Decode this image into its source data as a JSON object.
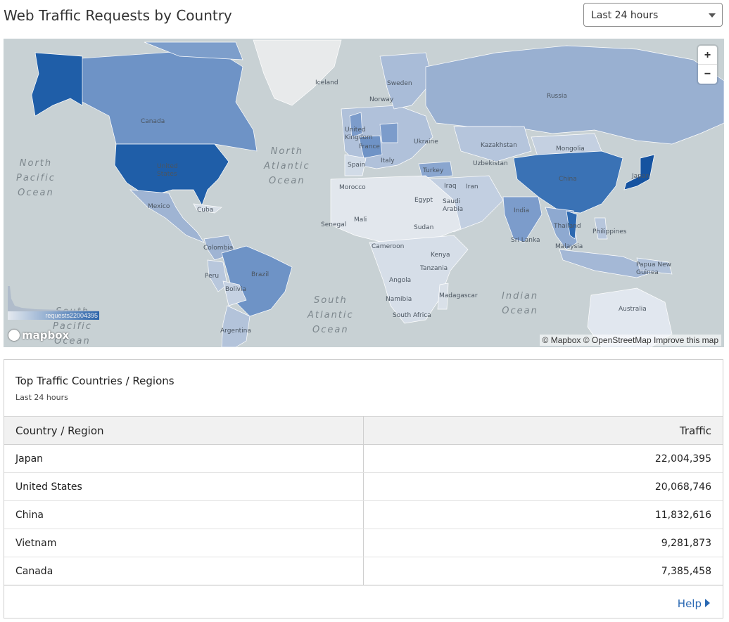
{
  "header": {
    "title": "Web Traffic Requests by Country",
    "range_select": {
      "selected": "Last 24 hours"
    }
  },
  "map": {
    "zoom_in": "+",
    "zoom_out": "−",
    "legend": {
      "label": "requests",
      "max_value": "22004395"
    },
    "logo": "mapbox",
    "attribution": "© Mapbox © OpenStreetMap Improve this map",
    "ocean_labels": {
      "north_pacific": "North\nPacific\nOcean",
      "north_atlantic": "North\nAtlantic\nOcean",
      "south_atlantic": "South\nAtlantic\nOcean",
      "indian": "Indian\nOcean",
      "south_pacific": "South\nPacific\nOcean"
    },
    "country_labels": [
      "Iceland",
      "Sweden",
      "Norway",
      "Russia",
      "United Kingdom",
      "France",
      "Ukraine",
      "Kazakhstan",
      "Mongolia",
      "Spain",
      "Italy",
      "Uzbekistan",
      "Turkey",
      "Morocco",
      "Iraq",
      "Iran",
      "China",
      "Japan",
      "Egypt",
      "Saudi Arabia",
      "India",
      "Mali",
      "Senegal",
      "Sudan",
      "Thailand",
      "Philippines",
      "Sri Lanka",
      "Malaysia",
      "Cameroon",
      "Kenya",
      "Tanzania",
      "Papua New Guinea",
      "Angola",
      "Namibia",
      "Madagascar",
      "South Africa",
      "Australia",
      "Canada",
      "United States",
      "Mexico",
      "Cuba",
      "Colombia",
      "Peru",
      "Brazil",
      "Bolivia",
      "Argentina"
    ],
    "colors": {
      "ocean": "#c8d1d4",
      "land_low": "#e4e9ef",
      "land_high": "#1f5ea8"
    }
  },
  "panel": {
    "title": "Top Traffic Countries / Regions",
    "subtitle": "Last 24 hours",
    "columns": {
      "country": "Country / Region",
      "traffic": "Traffic"
    },
    "rows": [
      {
        "country": "Japan",
        "traffic": "22,004,395"
      },
      {
        "country": "United States",
        "traffic": "20,068,746"
      },
      {
        "country": "China",
        "traffic": "11,832,616"
      },
      {
        "country": "Vietnam",
        "traffic": "9,281,873"
      },
      {
        "country": "Canada",
        "traffic": "7,385,458"
      }
    ],
    "help_label": "Help"
  }
}
